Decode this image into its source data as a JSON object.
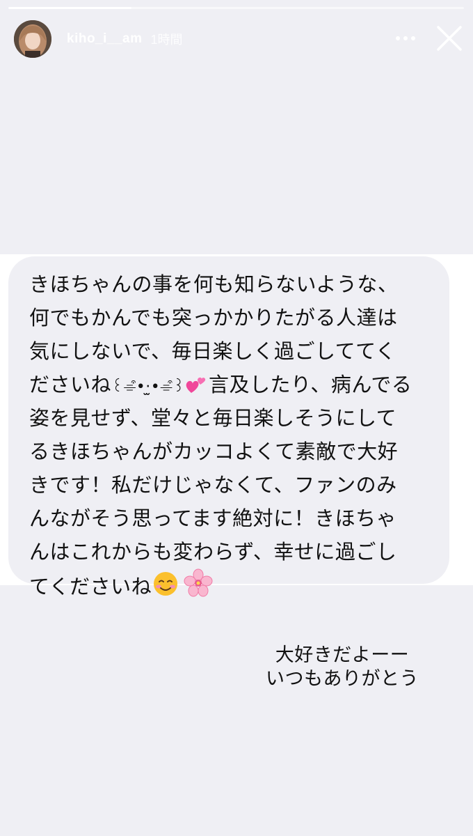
{
  "story": {
    "progress": 0.27,
    "username": "kiho_i__am",
    "timestamp": "1時間",
    "more_icon": "more-dots-icon",
    "close_icon": "close-icon"
  },
  "message": {
    "lines": [
      "きほちゃんの事を何も知らないような、",
      "何でもかんでも突っかかりたがる人達は",
      "気にしないで、毎日楽しく過ごしててく",
      "ださいね",
      "言及したり、病んでる",
      "姿を見せず、堂々と毎日楽しそうにして",
      "るきほちゃんがカッコよくて素敵で大好",
      "きです！私だけじゃなくて、ファンのみ",
      "んながそう思ってます絶対に！きほちゃ",
      "んはこれからも変わらず、幸せに過ごし",
      "てくださいね"
    ],
    "kaomoji": "꒰⌯͒•·̫•⌯͒꒱",
    "emoji": [
      "two-hearts-emoji",
      "smiling-face-emoji",
      "cherry-blossom-emoji"
    ]
  },
  "reply": {
    "line1": "大好きだよーー",
    "line2": "いつもありがとう"
  }
}
